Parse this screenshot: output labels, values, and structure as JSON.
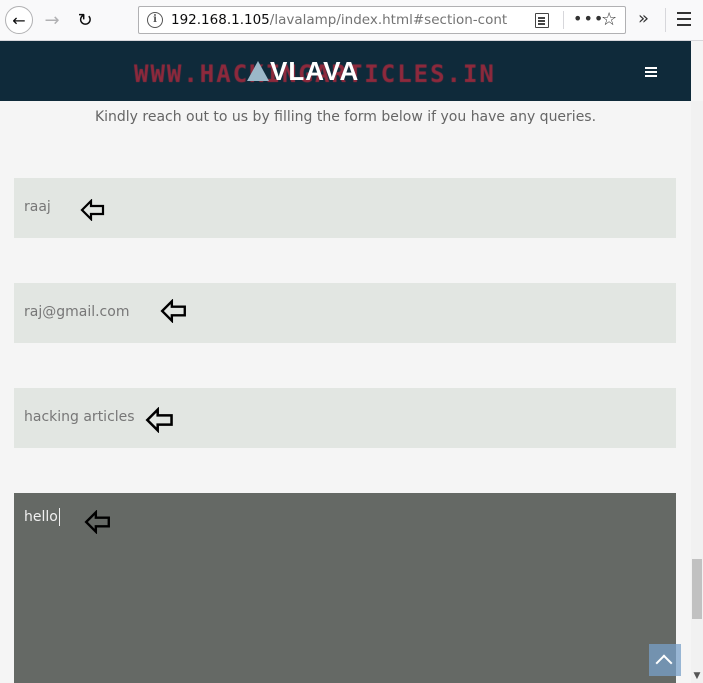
{
  "browser": {
    "url_host": "192.168.1.105",
    "url_path": "/lavalamp/index.html#section-cont",
    "more_label": "•••",
    "overflow_label": "»"
  },
  "site": {
    "logo_text": "VLAVA",
    "watermark": "WWW.HACKINGARTICLES.IN"
  },
  "contact": {
    "intro": "Kindly reach out to us by filling the form below if you have any queries.",
    "fields": [
      {
        "value": "raaj"
      },
      {
        "value": "raj@gmail.com"
      },
      {
        "value": "hacking articles"
      },
      {
        "value": "hello"
      }
    ]
  },
  "icons": {
    "back": "arrow-left-icon",
    "forward": "arrow-right-icon",
    "reload": "reload-icon",
    "info": "info-icon",
    "reader": "reader-view-icon",
    "bookmark": "star-icon",
    "menu": "hamburger-icon",
    "annotation": "hollow-arrow-left-icon",
    "back_to_top": "chevron-up-icon"
  },
  "colors": {
    "header_bg": "#0f2a3a",
    "field_bg": "#e2e6e2",
    "message_bg": "#656965",
    "back_to_top": "#78a0c8"
  }
}
